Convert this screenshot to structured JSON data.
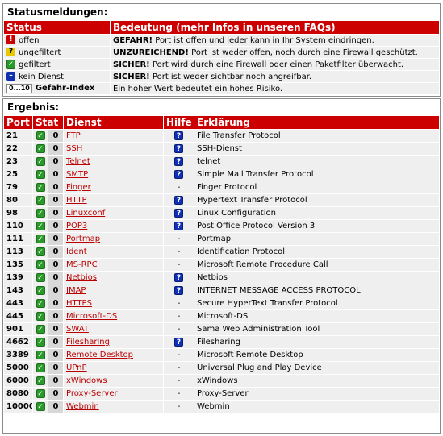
{
  "status_panel": {
    "title": "Statusmeldungen:",
    "col_status": "Status",
    "col_meaning": "Bedeutung (mehr Infos in unseren FAQs)",
    "rows": [
      {
        "icon": "exclamation-icon",
        "glyph": "!",
        "color": "red",
        "label": "offen",
        "bold": "GEFAHR!",
        "text": " Port ist offen und jeder kann in Ihr System eindringen."
      },
      {
        "icon": "question-icon",
        "glyph": "?",
        "color": "yellow",
        "label": "ungefiltert",
        "bold": "UNZUREICHEND!",
        "text": " Port ist weder offen, noch durch eine Firewall geschützt."
      },
      {
        "icon": "check-icon",
        "glyph": "✓",
        "color": "green",
        "label": "gefiltert",
        "bold": "SICHER!",
        "text": " Port wird durch eine Firewall oder einen Paketfilter überwacht."
      },
      {
        "icon": "minus-icon",
        "glyph": "–",
        "color": "blue",
        "label": "kein Dienst",
        "bold": "SICHER!",
        "text": " Port ist weder sichtbar noch angreifbar."
      }
    ],
    "index_row": {
      "range_lo": "0",
      "range_sep": "...",
      "range_hi": "10",
      "label": "Gefahr-Index",
      "text": "Ein hoher Wert bedeutet ein hohes Risiko."
    }
  },
  "result_panel": {
    "title": "Ergebnis:",
    "headers": {
      "port": "Port",
      "stat": "Stat",
      "dienst": "Dienst",
      "hilfe": "Hilfe",
      "erklaerung": "Erklärung"
    },
    "rows": [
      {
        "port": "21",
        "score": "0",
        "service": "FTP",
        "help": true,
        "desc": "File Transfer Protocol"
      },
      {
        "port": "22",
        "score": "0",
        "service": "SSH",
        "help": true,
        "desc": "SSH-Dienst"
      },
      {
        "port": "23",
        "score": "0",
        "service": "Telnet",
        "help": true,
        "desc": "telnet"
      },
      {
        "port": "25",
        "score": "0",
        "service": "SMTP",
        "help": true,
        "desc": "Simple Mail Transfer Protocol"
      },
      {
        "port": "79",
        "score": "0",
        "service": "Finger",
        "help": false,
        "desc": "Finger Protocol"
      },
      {
        "port": "80",
        "score": "0",
        "service": "HTTP",
        "help": true,
        "desc": "Hypertext Transfer Protocol"
      },
      {
        "port": "98",
        "score": "0",
        "service": "Linuxconf",
        "help": true,
        "desc": "Linux Configuration"
      },
      {
        "port": "110",
        "score": "0",
        "service": "POP3",
        "help": true,
        "desc": "Post Office Protocol Version 3"
      },
      {
        "port": "111",
        "score": "0",
        "service": "Portmap",
        "help": false,
        "desc": "Portmap"
      },
      {
        "port": "113",
        "score": "0",
        "service": "Ident",
        "help": false,
        "desc": "Identification Protocol"
      },
      {
        "port": "135",
        "score": "0",
        "service": "MS-RPC",
        "help": false,
        "desc": "Microsoft Remote Procedure Call"
      },
      {
        "port": "139",
        "score": "0",
        "service": "Netbios",
        "help": true,
        "desc": "Netbios"
      },
      {
        "port": "143",
        "score": "0",
        "service": "IMAP",
        "help": true,
        "desc": "INTERNET MESSAGE ACCESS PROTOCOL"
      },
      {
        "port": "443",
        "score": "0",
        "service": "HTTPS",
        "help": false,
        "desc": "Secure HyperText Transfer Protocol"
      },
      {
        "port": "445",
        "score": "0",
        "service": "Microsoft-DS",
        "help": false,
        "desc": "Microsoft-DS"
      },
      {
        "port": "901",
        "score": "0",
        "service": "SWAT",
        "help": false,
        "desc": "Sama Web Administration Tool"
      },
      {
        "port": "4662",
        "score": "0",
        "service": "Filesharing",
        "help": true,
        "desc": "Filesharing"
      },
      {
        "port": "3389",
        "score": "0",
        "service": "Remote Desktop",
        "help": false,
        "desc": "Microsoft Remote Desktop"
      },
      {
        "port": "5000",
        "score": "0",
        "service": "UPnP",
        "help": false,
        "desc": "Universal Plug and Play Device"
      },
      {
        "port": "6000",
        "score": "0",
        "service": "xWindows",
        "help": false,
        "desc": "xWindows"
      },
      {
        "port": "8080",
        "score": "0",
        "service": "Proxy-Server",
        "help": false,
        "desc": "Proxy-Server"
      },
      {
        "port": "10000",
        "score": "0",
        "service": "Webmin",
        "help": false,
        "desc": "Webmin"
      }
    ],
    "no_help_text": "-"
  },
  "colors": {
    "header": "#cc0000",
    "cell": "#efefef",
    "link": "#bb0000",
    "ok_green": "#2a9a2a",
    "help_blue": "#1030b8"
  }
}
